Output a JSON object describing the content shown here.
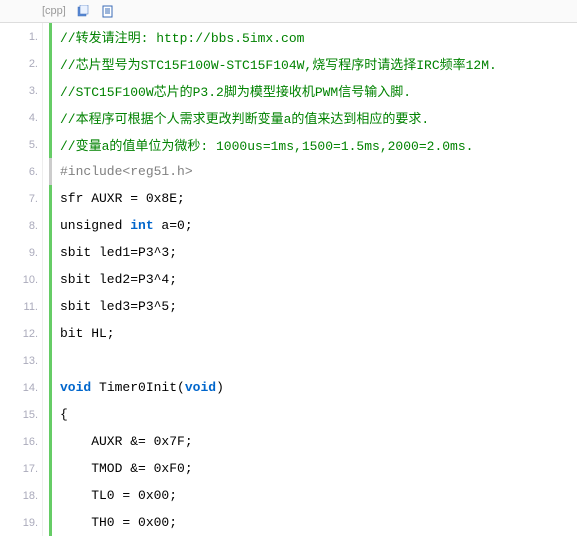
{
  "header": {
    "language": "[cpp]",
    "icons": {
      "copy": "copy-icon",
      "view": "view-icon"
    }
  },
  "gutter_suffix": ".",
  "lines": [
    {
      "n": 1,
      "bar": "green",
      "tokens": [
        {
          "cls": "comment",
          "t": "//转发请注明: http://bbs.5imx.com"
        }
      ]
    },
    {
      "n": 2,
      "bar": "green",
      "tokens": [
        {
          "cls": "comment",
          "t": "//芯片型号为STC15F100W-STC15F104W,烧写程序时请选择IRC频率12M."
        }
      ]
    },
    {
      "n": 3,
      "bar": "green",
      "tokens": [
        {
          "cls": "comment",
          "t": "//STC15F100W芯片的P3.2脚为模型接收机PWM信号输入脚."
        }
      ]
    },
    {
      "n": 4,
      "bar": "green",
      "tokens": [
        {
          "cls": "comment",
          "t": "//本程序可根据个人需求更改判断变量a的值来达到相应的要求."
        }
      ]
    },
    {
      "n": 5,
      "bar": "green",
      "tokens": [
        {
          "cls": "comment",
          "t": "//变量a的值单位为微秒: 1000us=1ms,1500=1.5ms,2000=2.0ms."
        }
      ]
    },
    {
      "n": 6,
      "bar": "gray",
      "tokens": [
        {
          "cls": "preproc",
          "t": "#include<reg51.h>"
        }
      ]
    },
    {
      "n": 7,
      "bar": "green",
      "tokens": [
        {
          "cls": "plain",
          "t": "sfr AUXR = 0x8E;"
        }
      ]
    },
    {
      "n": 8,
      "bar": "green",
      "tokens": [
        {
          "cls": "plain",
          "t": "unsigned "
        },
        {
          "cls": "type",
          "t": "int"
        },
        {
          "cls": "plain",
          "t": " a=0;"
        }
      ]
    },
    {
      "n": 9,
      "bar": "green",
      "tokens": [
        {
          "cls": "plain",
          "t": "sbit led1=P3^3;"
        }
      ]
    },
    {
      "n": 10,
      "bar": "green",
      "tokens": [
        {
          "cls": "plain",
          "t": "sbit led2=P3^4;"
        }
      ]
    },
    {
      "n": 11,
      "bar": "green",
      "tokens": [
        {
          "cls": "plain",
          "t": "sbit led3=P3^5;"
        }
      ]
    },
    {
      "n": 12,
      "bar": "green",
      "tokens": [
        {
          "cls": "plain",
          "t": "bit HL;"
        }
      ]
    },
    {
      "n": 13,
      "bar": "green",
      "tokens": [
        {
          "cls": "plain",
          "t": " "
        }
      ]
    },
    {
      "n": 14,
      "bar": "green",
      "tokens": [
        {
          "cls": "void",
          "t": "void"
        },
        {
          "cls": "plain",
          "t": " Timer0Init("
        },
        {
          "cls": "void",
          "t": "void"
        },
        {
          "cls": "plain",
          "t": ")"
        }
      ]
    },
    {
      "n": 15,
      "bar": "green",
      "tokens": [
        {
          "cls": "plain",
          "t": "{"
        }
      ]
    },
    {
      "n": 16,
      "bar": "green",
      "tokens": [
        {
          "cls": "plain",
          "t": "    AUXR &= 0x7F;"
        }
      ]
    },
    {
      "n": 17,
      "bar": "green",
      "tokens": [
        {
          "cls": "plain",
          "t": "    TMOD &= 0xF0;"
        }
      ]
    },
    {
      "n": 18,
      "bar": "green",
      "tokens": [
        {
          "cls": "plain",
          "t": "    TL0 = 0x00;"
        }
      ]
    },
    {
      "n": 19,
      "bar": "green",
      "tokens": [
        {
          "cls": "plain",
          "t": "    TH0 = 0x00;"
        }
      ]
    }
  ]
}
